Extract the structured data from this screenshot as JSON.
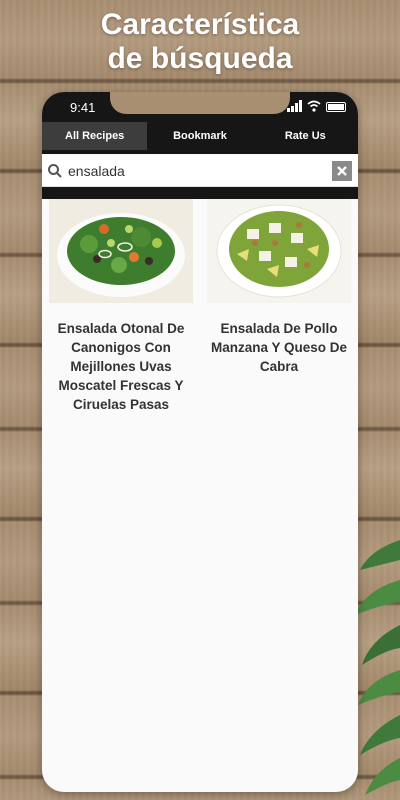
{
  "headline": {
    "line1": "Característica",
    "line2": "de búsqueda"
  },
  "status_bar": {
    "time": "9:41"
  },
  "tabs": [
    {
      "label": "All Recipes",
      "active": true
    },
    {
      "label": "Bookmark",
      "active": false
    },
    {
      "label": "Rate Us",
      "active": false
    }
  ],
  "search": {
    "value": "ensalada"
  },
  "recipes": [
    {
      "title": "Ensalada Otonal De Canonigos Con Mejillones Uvas Moscatel Frescas Y Ciruelas Pasas"
    },
    {
      "title": "Ensalada De Pollo Manzana Y Queso De Cabra"
    }
  ],
  "colors": {
    "tab_bar": "#161616",
    "active_tab": "#3d3d3d",
    "clear_button": "#8a8a8a"
  }
}
